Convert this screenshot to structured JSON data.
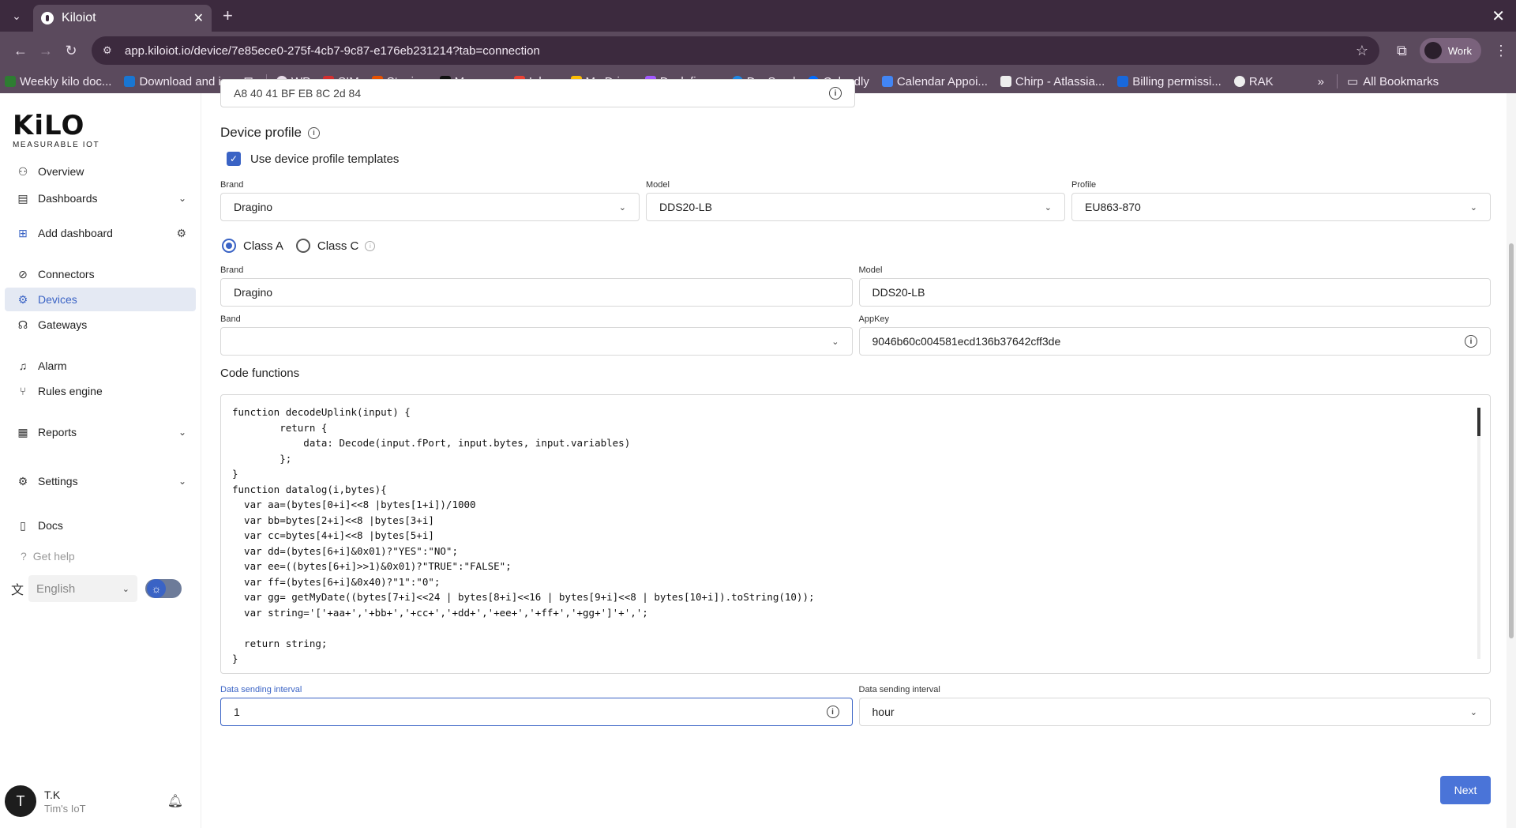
{
  "browser": {
    "tab_title": "Kiloiot",
    "url": "app.kiloiot.io/device/7e85ece0-275f-4cb7-9c87-e176eb231214?tab=connection",
    "profile_label": "Work",
    "bookmarks": [
      {
        "label": "Weekly kilo doc...",
        "color": "#2e7d32"
      },
      {
        "label": "Download and i...",
        "color": "#1976d2"
      },
      {
        "label": "WP",
        "color": "#e8dde9"
      },
      {
        "label": "SIM",
        "color": "#d32f2f"
      },
      {
        "label": "Staging",
        "color": "#e65100"
      },
      {
        "label": "Manager",
        "color": "#111111"
      },
      {
        "label": "Inbox",
        "color": "#ea4335"
      },
      {
        "label": "My Drive",
        "color": "#fbbc04"
      },
      {
        "label": "Deck figma",
        "color": "#a259ff"
      },
      {
        "label": "DocSend",
        "color": "#1e88e5"
      },
      {
        "label": "Calendly",
        "color": "#006bff"
      },
      {
        "label": "Calendar Appoi...",
        "color": "#4285f4"
      },
      {
        "label": "Chirp - Atlassia...",
        "color": "#eeeeee"
      },
      {
        "label": "Billing permissi...",
        "color": "#1868db"
      },
      {
        "label": "RAK",
        "color": "#eeeeee"
      }
    ],
    "all_bookmarks_label": "All Bookmarks"
  },
  "sidebar": {
    "logo_text": "KiLO",
    "logo_sub": "MEASURABLE IOT",
    "items": [
      {
        "label": "Overview"
      },
      {
        "label": "Dashboards"
      },
      {
        "label": "Add dashboard"
      },
      {
        "label": "Connectors"
      },
      {
        "label": "Devices"
      },
      {
        "label": "Gateways"
      },
      {
        "label": "Alarm"
      },
      {
        "label": "Rules engine"
      },
      {
        "label": "Reports"
      },
      {
        "label": "Settings"
      },
      {
        "label": "Docs"
      }
    ],
    "get_help": "Get help",
    "language": "English",
    "user_initial": "T",
    "user_name": "T.K",
    "user_org": "Tim's IoT"
  },
  "form": {
    "top_field_value": "A8 40 41 BF EB 8C 2d 84",
    "device_profile_title": "Device profile",
    "use_templates_label": "Use device profile templates",
    "brand_label": "Brand",
    "brand_value": "Dragino",
    "model_label": "Model",
    "model_value": "DDS20-LB",
    "profile_label": "Profile",
    "profile_value": "EU863-870",
    "class_a": "Class A",
    "class_c": "Class C",
    "brand2_label": "Brand",
    "brand2_value": "Dragino",
    "model2_label": "Model",
    "model2_value": "DDS20-LB",
    "band_label": "Band",
    "band_value": "",
    "appkey_label": "AppKey",
    "appkey_value": "9046b60c004581ecd136b37642cff3de",
    "code_functions_title": "Code functions",
    "code": "function decodeUplink(input) {\n        return {\n            data: Decode(input.fPort, input.bytes, input.variables)\n        };\n}\nfunction datalog(i,bytes){\n  var aa=(bytes[0+i]<<8 |bytes[1+i])/1000\n  var bb=bytes[2+i]<<8 |bytes[3+i]\n  var cc=bytes[4+i]<<8 |bytes[5+i]\n  var dd=(bytes[6+i]&0x01)?\"YES\":\"NO\";\n  var ee=((bytes[6+i]>>1)&0x01)?\"TRUE\":\"FALSE\";\n  var ff=(bytes[6+i]&0x40)?\"1\":\"0\";\n  var gg= getMyDate((bytes[7+i]<<24 | bytes[8+i]<<16 | bytes[9+i]<<8 | bytes[10+i]).toString(10));\n  var string='['+aa+','+bb+','+cc+','+dd+','+ee+','+ff+','+gg+']'+',';\n\n  return string;\n}",
    "interval_label": "Data sending interval",
    "interval_value": "1",
    "interval_unit_label": "Data sending interval",
    "interval_unit_value": "hour",
    "next_label": "Next"
  }
}
